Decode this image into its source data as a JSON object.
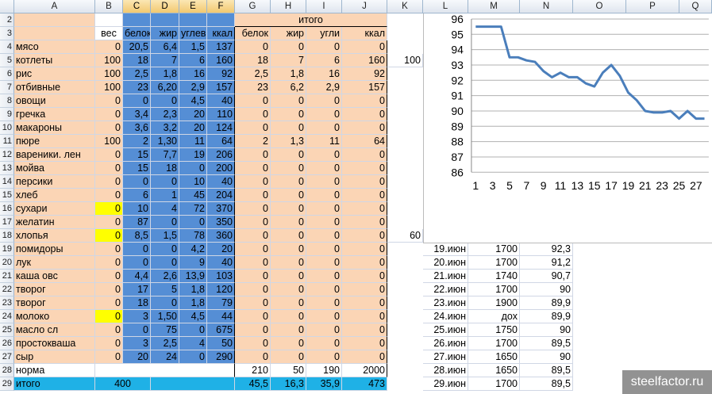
{
  "columns": [
    "A",
    "B",
    "C",
    "D",
    "E",
    "F",
    "G",
    "H",
    "I",
    "J",
    "K",
    "L",
    "M",
    "N",
    "O",
    "P",
    "Q"
  ],
  "header_row2": {
    "itogo": "итого"
  },
  "header_row3": {
    "B": "вес",
    "C": "белок",
    "D": "жир",
    "E": "углев",
    "F": "ккал",
    "G": "белок",
    "H": "жир",
    "I": "угли",
    "J": "ккал"
  },
  "rows": [
    {
      "n": "4",
      "name": "мясо",
      "B": "0",
      "C": "20,5",
      "D": "6,4",
      "E": "1,5",
      "F": "137",
      "G": "0",
      "H": "0",
      "I": "0",
      "J": "0"
    },
    {
      "n": "5",
      "name": "котлеты",
      "B": "100",
      "C": "18",
      "D": "7",
      "E": "6",
      "F": "160",
      "G": "18",
      "H": "7",
      "I": "6",
      "J": "160"
    },
    {
      "n": "6",
      "name": "рис",
      "B": "100",
      "C": "2,5",
      "D": "1,8",
      "E": "16",
      "F": "92",
      "G": "2,5",
      "H": "1,8",
      "I": "16",
      "J": "92"
    },
    {
      "n": "7",
      "name": "отбивные",
      "B": "100",
      "C": "23",
      "D": "6,20",
      "E": "2,9",
      "F": "157",
      "G": "23",
      "H": "6,2",
      "I": "2,9",
      "J": "157"
    },
    {
      "n": "8",
      "name": "овощи",
      "B": "0",
      "C": "0",
      "D": "0",
      "E": "4,5",
      "F": "40",
      "G": "0",
      "H": "0",
      "I": "0",
      "J": "0"
    },
    {
      "n": "9",
      "name": "гречка",
      "B": "0",
      "C": "3,4",
      "D": "2,3",
      "E": "20",
      "F": "110",
      "G": "0",
      "H": "0",
      "I": "0",
      "J": "0"
    },
    {
      "n": "10",
      "name": "макароны",
      "B": "0",
      "C": "3,6",
      "D": "3,2",
      "E": "20",
      "F": "124",
      "G": "0",
      "H": "0",
      "I": "0",
      "J": "0"
    },
    {
      "n": "11",
      "name": "пюре",
      "B": "100",
      "C": "2",
      "D": "1,30",
      "E": "11",
      "F": "64",
      "G": "2",
      "H": "1,3",
      "I": "11",
      "J": "64"
    },
    {
      "n": "12",
      "name": "вареники. лен",
      "B": "0",
      "C": "15",
      "D": "7,7",
      "E": "19",
      "F": "206",
      "G": "0",
      "H": "0",
      "I": "0",
      "J": "0"
    },
    {
      "n": "13",
      "name": "мойва",
      "B": "0",
      "C": "15",
      "D": "18",
      "E": "0",
      "F": "200",
      "G": "0",
      "H": "0",
      "I": "0",
      "J": "0"
    },
    {
      "n": "14",
      "name": "персики",
      "B": "0",
      "C": "0",
      "D": "0",
      "E": "10",
      "F": "40",
      "G": "0",
      "H": "0",
      "I": "0",
      "J": "0"
    },
    {
      "n": "15",
      "name": "хлеб",
      "B": "0",
      "C": "6",
      "D": "1",
      "E": "45",
      "F": "204",
      "G": "0",
      "H": "0",
      "I": "0",
      "J": "0"
    },
    {
      "n": "16",
      "name": "сухари",
      "B": "0",
      "C": "10",
      "D": "4",
      "E": "72",
      "F": "370",
      "G": "0",
      "H": "0",
      "I": "0",
      "J": "0",
      "yellow": true
    },
    {
      "n": "17",
      "name": "желатин",
      "B": "0",
      "C": "87",
      "D": "0",
      "E": "0",
      "F": "350",
      "G": "0",
      "H": "0",
      "I": "0",
      "J": "0"
    },
    {
      "n": "18",
      "name": "хлопья",
      "B": "0",
      "C": "8,5",
      "D": "1,5",
      "E": "78",
      "F": "360",
      "G": "0",
      "H": "0",
      "I": "0",
      "J": "0",
      "yellow": true
    },
    {
      "n": "19",
      "name": "помидоры",
      "B": "0",
      "C": "0",
      "D": "0",
      "E": "4,2",
      "F": "20",
      "G": "0",
      "H": "0",
      "I": "0",
      "J": "0"
    },
    {
      "n": "20",
      "name": "лук",
      "B": "0",
      "C": "0",
      "D": "0",
      "E": "9",
      "F": "40",
      "G": "0",
      "H": "0",
      "I": "0",
      "J": "0"
    },
    {
      "n": "21",
      "name": "каша овс",
      "B": "0",
      "C": "4,4",
      "D": "2,6",
      "E": "13,9",
      "F": "103",
      "G": "0",
      "H": "0",
      "I": "0",
      "J": "0"
    },
    {
      "n": "22",
      "name": "творог",
      "B": "0",
      "C": "17",
      "D": "5",
      "E": "1,8",
      "F": "120",
      "G": "0",
      "H": "0",
      "I": "0",
      "J": "0"
    },
    {
      "n": "23",
      "name": "творог",
      "B": "0",
      "C": "18",
      "D": "0",
      "E": "1,8",
      "F": "79",
      "G": "0",
      "H": "0",
      "I": "0",
      "J": "0"
    },
    {
      "n": "24",
      "name": "молоко",
      "B": "0",
      "C": "3",
      "D": "1,50",
      "E": "4,5",
      "F": "44",
      "G": "0",
      "H": "0",
      "I": "0",
      "J": "0",
      "yellow": true
    },
    {
      "n": "25",
      "name": "масло сл",
      "B": "0",
      "C": "0",
      "D": "75",
      "E": "0",
      "F": "675",
      "G": "0",
      "H": "0",
      "I": "0",
      "J": "0"
    },
    {
      "n": "26",
      "name": "  простокваша",
      "B": "0",
      "C": "3",
      "D": "2,5",
      "E": "4",
      "F": "50",
      "G": "0",
      "H": "0",
      "I": "0",
      "J": "0"
    },
    {
      "n": "27",
      "name": "сыр",
      "B": "0",
      "C": "20",
      "D": "24",
      "E": "0",
      "F": "290",
      "G": "0",
      "H": "0",
      "I": "0",
      "J": "0"
    }
  ],
  "norma": {
    "n": "28",
    "name": "норма",
    "G": "210",
    "H": "50",
    "I": "190",
    "J": "2000"
  },
  "itogo": {
    "n": "29",
    "name": "итого",
    "B": "400",
    "G": "45,5",
    "H": "16,3",
    "I": "35,9",
    "J": "473"
  },
  "k_values": {
    "row5": "100",
    "row18": "60"
  },
  "log": [
    {
      "row": "19",
      "date": "19.июн",
      "kcal": "1700",
      "weight": "92,3"
    },
    {
      "row": "20",
      "date": "20.июн",
      "kcal": "1700",
      "weight": "91,2"
    },
    {
      "row": "21",
      "date": "21.июн",
      "kcal": "1740",
      "weight": "90,7"
    },
    {
      "row": "22",
      "date": "22.июн",
      "kcal": "1700",
      "weight": "90"
    },
    {
      "row": "23",
      "date": "23.июн",
      "kcal": "1900",
      "weight": "89,9"
    },
    {
      "row": "24",
      "date": "24.июн",
      "kcal": "дох",
      "weight": "89,9"
    },
    {
      "row": "25",
      "date": "25.июн",
      "kcal": "1750",
      "weight": "90"
    },
    {
      "row": "26",
      "date": "26.июн",
      "kcal": "1700",
      "weight": "89,5"
    },
    {
      "row": "27",
      "date": "27.июн",
      "kcal": "1650",
      "weight": "90"
    },
    {
      "row": "28",
      "date": "28.июн",
      "kcal": "1650",
      "weight": "89,5"
    },
    {
      "row": "29",
      "date": "29.июн",
      "kcal": "1700",
      "weight": "89,5"
    }
  ],
  "chart_data": {
    "type": "line",
    "title": "",
    "xlabel": "",
    "ylabel": "",
    "ylim": [
      86,
      96
    ],
    "yticks": [
      "96",
      "95",
      "94",
      "93",
      "92",
      "91",
      "90",
      "89",
      "88",
      "87",
      "86"
    ],
    "xticks": [
      "1",
      "3",
      "5",
      "7",
      "9",
      "11",
      "13",
      "15",
      "17",
      "19",
      "21",
      "23",
      "25",
      "27"
    ],
    "x": [
      1,
      2,
      3,
      4,
      5,
      6,
      7,
      8,
      9,
      10,
      11,
      12,
      13,
      14,
      15,
      16,
      17,
      18,
      19,
      20,
      21,
      22,
      23,
      24,
      25,
      26,
      27,
      28
    ],
    "series": [
      {
        "values": [
          95.5,
          95.5,
          95.5,
          95.5,
          93.5,
          93.5,
          93.3,
          93.2,
          92.6,
          92.2,
          92.5,
          92.2,
          92.2,
          91.8,
          91.6,
          92.5,
          93.0,
          92.3,
          91.2,
          90.7,
          90.0,
          89.9,
          89.9,
          90.0,
          89.5,
          90.0,
          89.5,
          89.5
        ]
      }
    ],
    "line_color": "#4a7ebb"
  },
  "watermark": "steelfactor.ru"
}
